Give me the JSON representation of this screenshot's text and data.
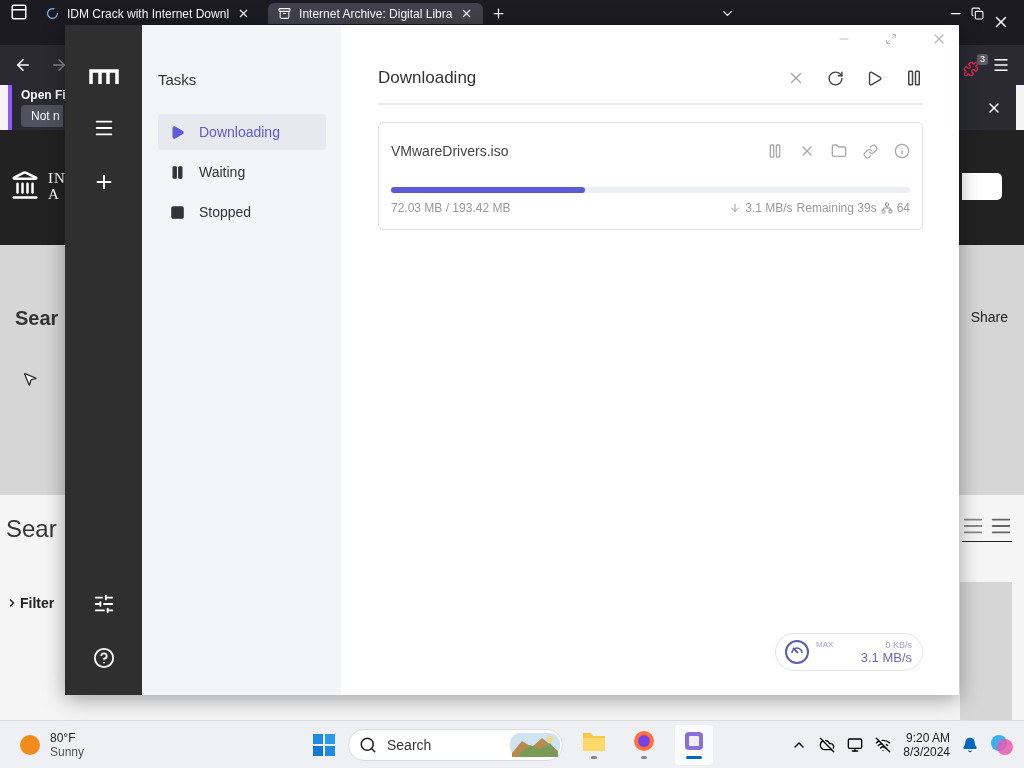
{
  "browser": {
    "tabs": [
      {
        "title": "IDM Crack with Internet Downl",
        "selected": false
      },
      {
        "title": "Internet Archive: Digital Libra",
        "selected": true
      }
    ],
    "extension_badge": "3",
    "notification": {
      "title": "Open Fi",
      "button": "Not n"
    },
    "site": {
      "logo_lines": [
        "IN",
        "A"
      ],
      "heading": "Sear",
      "share": "Share",
      "results_heading": "Sear",
      "filters": "Filter"
    }
  },
  "app": {
    "sidebar_title": "Tasks",
    "sidebar_items": [
      {
        "label": "Downloading",
        "kind": "play",
        "selected": true
      },
      {
        "label": "Waiting",
        "kind": "pause",
        "selected": false
      },
      {
        "label": "Stopped",
        "kind": "stop",
        "selected": false
      }
    ],
    "main_title": "Downloading",
    "tasks": [
      {
        "name": "VMwareDrivers.iso",
        "level": 0.373,
        "size": "72.03 MB / 193.42 MB",
        "speed": "3.1 MB/s",
        "remaining": "Remaining 39s",
        "connections": "64"
      }
    ],
    "speed_widget": {
      "label": "MAX",
      "upload": "0 KB/s",
      "download": "3.1 MB/s"
    }
  },
  "taskbar": {
    "weather": {
      "temperature": "80°F",
      "condition": "Sunny"
    },
    "search": {
      "placeholder": "Search"
    },
    "apps": [
      {
        "kind": "folder",
        "selected": false
      },
      {
        "kind": "browser",
        "selected": false
      },
      {
        "kind": "downloader",
        "selected": true
      }
    ],
    "time": "9:20 AM",
    "date": "8/3/2024"
  }
}
